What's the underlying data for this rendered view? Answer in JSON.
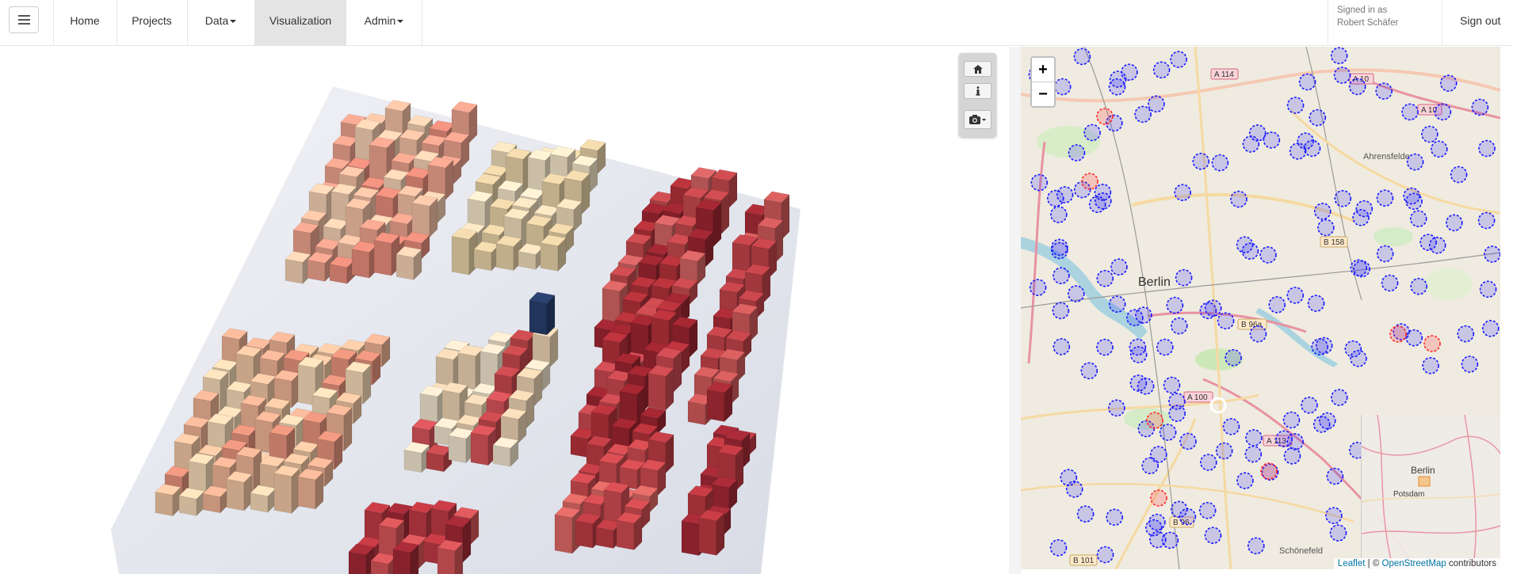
{
  "nav": {
    "menu_icon": "hamburger-icon",
    "items": [
      {
        "label": "Home"
      },
      {
        "label": "Projects"
      },
      {
        "label": "Data"
      },
      {
        "label": "Visualization"
      },
      {
        "label": "Admin"
      }
    ],
    "signed_in_label": "Signed in as",
    "user_name": "Robert Schäfer",
    "sign_out": "Sign out"
  },
  "toolbar": {
    "home_icon": "home-icon",
    "info_icon": "info-icon",
    "camera_icon": "camera-icon"
  },
  "map": {
    "zoom_in": "+",
    "zoom_out": "−",
    "labels": {
      "berlin": "Berlin",
      "ahrensfelde": "Ahrensfelde",
      "schonefeld": "Schönefeld",
      "a10a": "A 10",
      "a10b": "A 10",
      "a114": "A 114",
      "a100": "A 100",
      "a113": "A 113",
      "b96a": "B 96a",
      "b96": "B 96",
      "b101": "B 101",
      "b158": "B 158"
    },
    "minimap": {
      "berlin": "Berlin",
      "potsdam": "Potsdam"
    },
    "attribution": {
      "leaflet": "Leaflet",
      "sep": "| ©",
      "osm": "OpenStreetMap",
      "contributors": "contributors"
    },
    "colors": {
      "marker_blue": "#1a1aff",
      "marker_red": "#ff2a2a",
      "selected": "#ffffff"
    }
  }
}
